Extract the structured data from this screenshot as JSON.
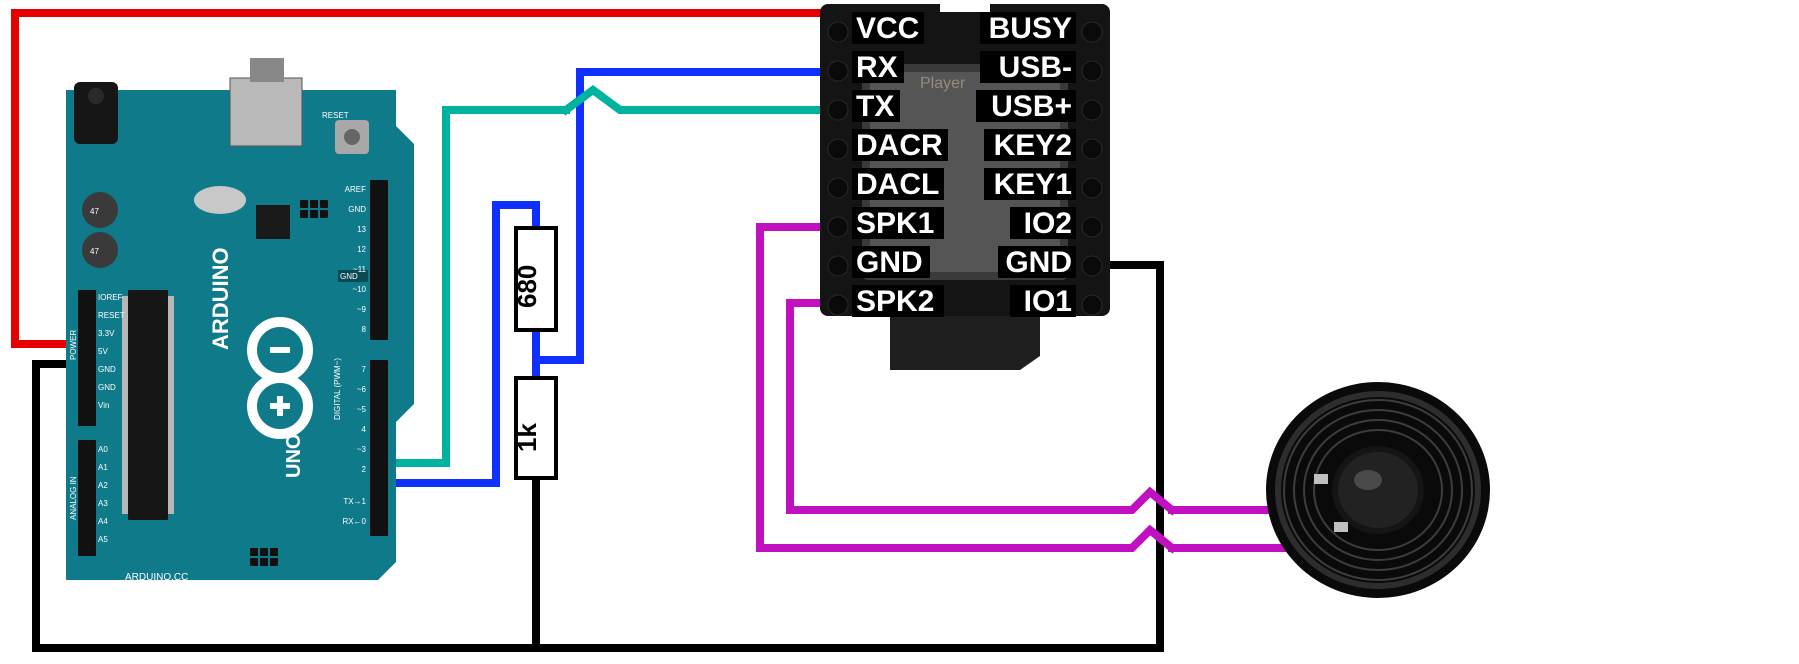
{
  "arduino": {
    "brand": "ARDUINO",
    "model": "UNO",
    "url": "ARDUINO.CC",
    "power_label": "POWER",
    "analog_label": "ANALOG IN",
    "digital_label": "DIGITAL (PWM~)",
    "reset_btn": "RESET",
    "pins_digital_top": [
      "AREF",
      "GND",
      "13",
      "12",
      "~11",
      "~10",
      "~9",
      "8"
    ],
    "pins_digital_bot": [
      "7",
      "~6",
      "~5",
      "4",
      "~3",
      "2",
      "TX→1",
      "RX←0"
    ],
    "pins_power": [
      "IOREF",
      "RESET",
      "3.3V",
      "5V",
      "GND",
      "GND",
      "Vin"
    ],
    "pins_analog": [
      "A0",
      "A1",
      "A2",
      "A3",
      "A4",
      "A5"
    ]
  },
  "dfplayer": {
    "left_pins": [
      "VCC",
      "RX",
      "TX",
      "DACR",
      "DACL",
      "SPK1",
      "GND",
      "SPK2"
    ],
    "right_pins": [
      "BUSY",
      "USB-",
      "USB+",
      "KEY2",
      "KEY1",
      "IO2",
      "GND",
      "IO1"
    ],
    "chip_text": "Player"
  },
  "resistors": {
    "r1": "680",
    "r2": "1k"
  },
  "wires": {
    "vcc": {
      "color": "#e60000",
      "from": "Arduino 5V",
      "to": "DFPlayer VCC"
    },
    "gnd_arduino": {
      "color": "#000000",
      "from": "Arduino GND",
      "to": "common ground"
    },
    "gnd_dfplayer": {
      "color": "#000000",
      "from": "DFPlayer GND (right)",
      "to": "common ground"
    },
    "tx_to_rx": {
      "color": "#1030ff",
      "from": "Arduino D2",
      "via": "680Ω+1kΩ divider",
      "to": "DFPlayer RX"
    },
    "rx_from_tx": {
      "color": "#00b39f",
      "from": "DFPlayer TX",
      "to": "Arduino D3"
    },
    "spk1": {
      "color": "#c010c0",
      "from": "DFPlayer SPK1",
      "to": "Speaker +"
    },
    "spk2": {
      "color": "#c010c0",
      "from": "DFPlayer SPK2",
      "to": "Speaker −"
    }
  },
  "speaker": {
    "name": "speaker"
  }
}
